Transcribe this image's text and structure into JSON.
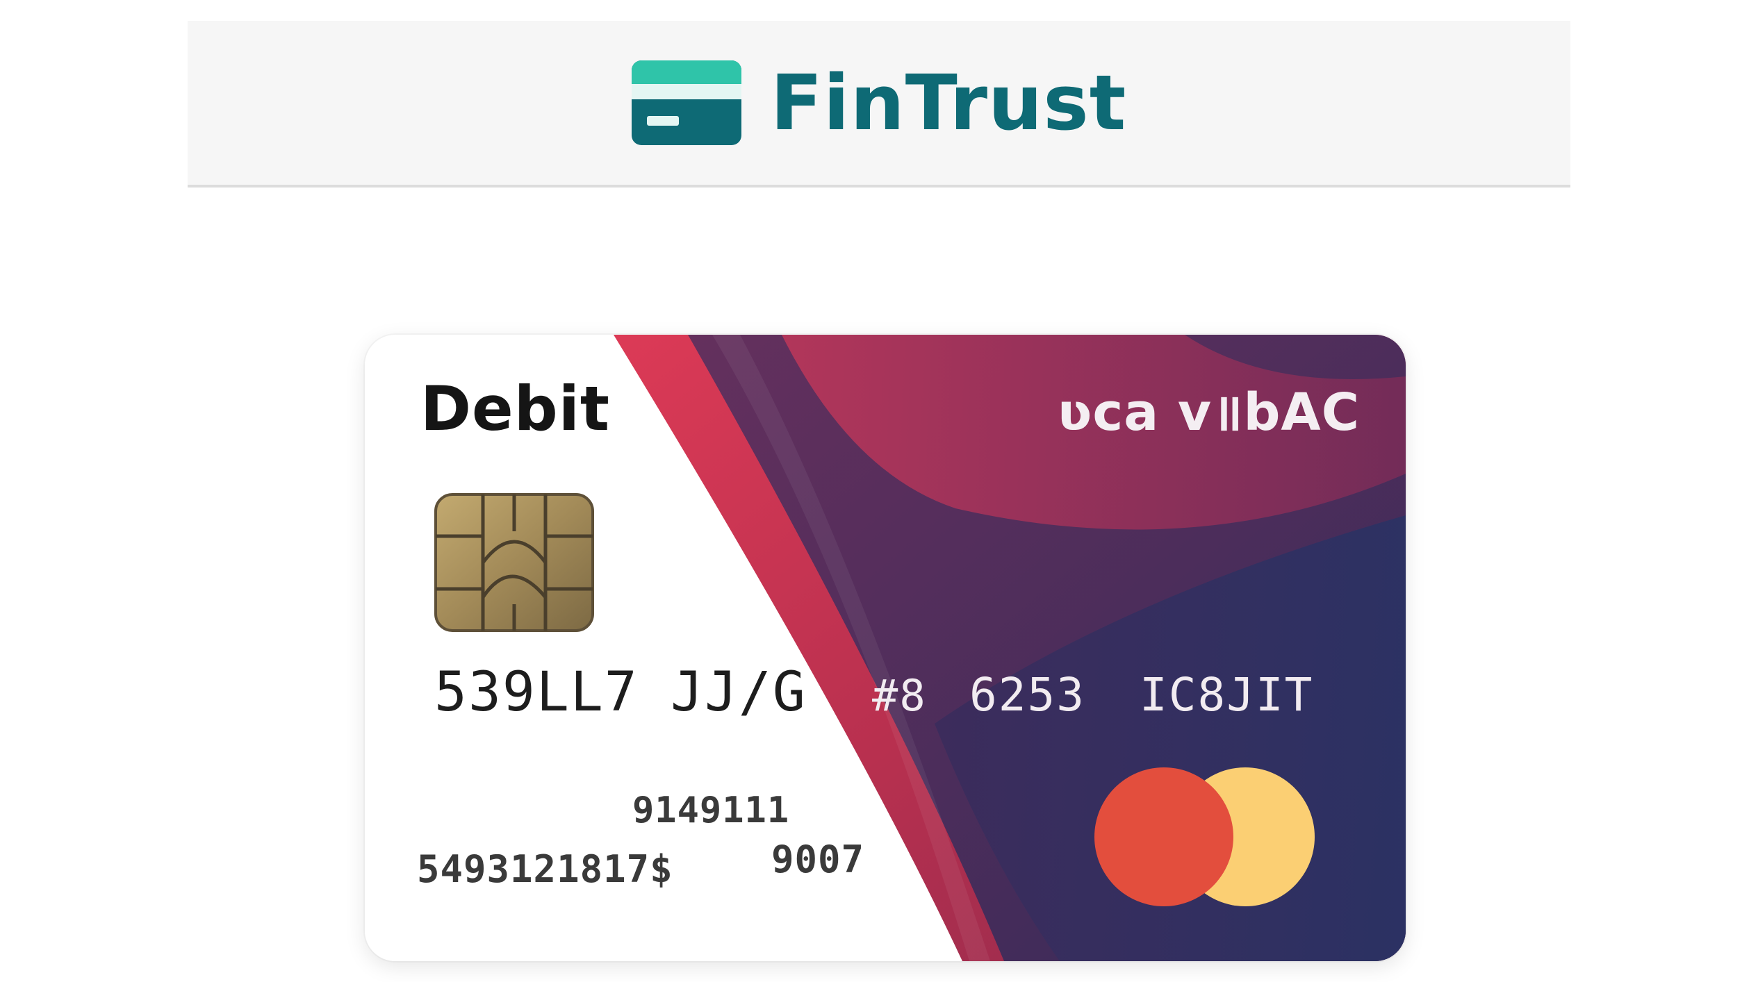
{
  "header": {
    "brand_name": "FinTrust",
    "logo_icon": "credit-card-icon",
    "colors": {
      "brand_text": "#0e6a75",
      "logo_top": "#2fc4a9",
      "logo_body": "#0e6a75"
    }
  },
  "card": {
    "type_label": "Debit",
    "bank_mark": "ʋca v॥bAC",
    "number_groups": [
      "539LL7",
      "JJ/G",
      "#8",
      "6253",
      "IC8JIT"
    ],
    "small_text_1": "9149111",
    "small_text_2": "5493121817$",
    "small_text_3": "9007",
    "chip_icon": "emv-chip-icon",
    "network_icon": "mastercard-circles-icon",
    "colors": {
      "crimson": "#c8324e",
      "plum": "#4b2a59",
      "navy": "#2c2f5c",
      "chip_gold": "#a8915e",
      "network_red": "#e34e3d",
      "network_yellow": "#fbcf73"
    }
  }
}
